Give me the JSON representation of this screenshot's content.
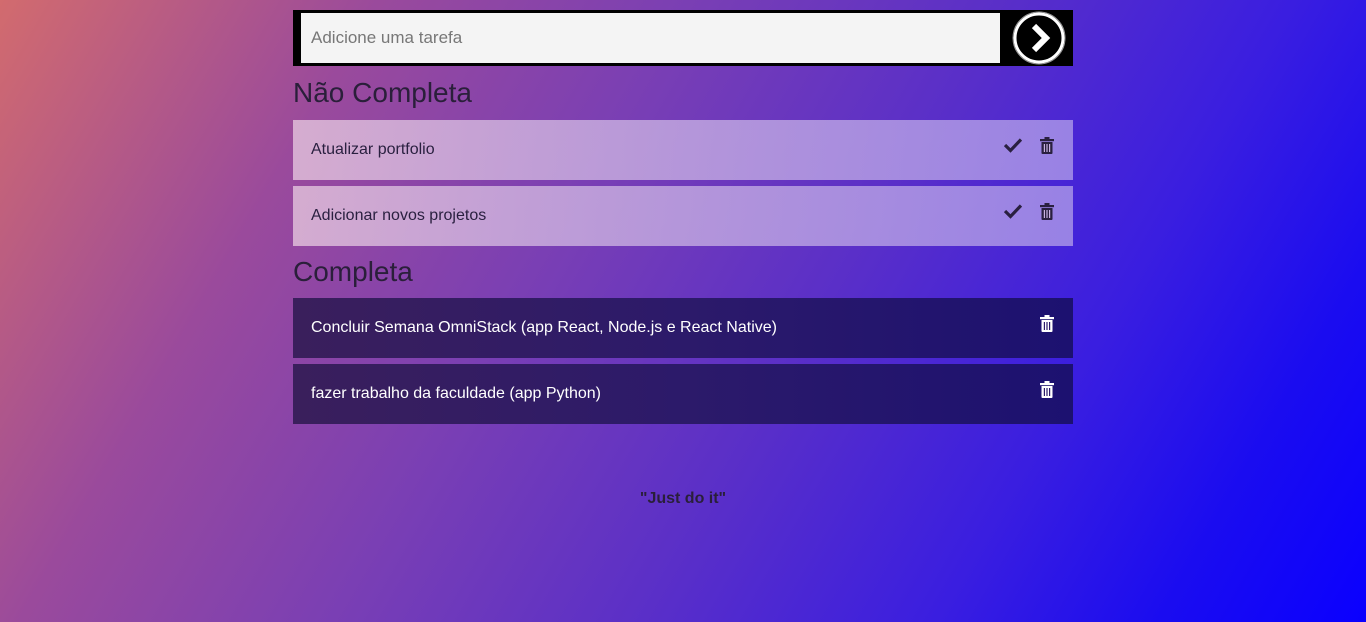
{
  "add_task": {
    "placeholder": "Adicione uma tarefa",
    "value": "",
    "submit_icon": "chevron-right-circle-icon"
  },
  "sections": {
    "pending_title": "Não Completa",
    "completed_title": "Completa"
  },
  "pending_tasks": [
    {
      "label": "Atualizar portfolio"
    },
    {
      "label": "Adicionar novos projetos"
    }
  ],
  "completed_tasks": [
    {
      "label": "Concluir Semana OmniStack (app React, Node.js e React Native)"
    },
    {
      "label": "fazer trabalho da faculdade (app Python)"
    }
  ],
  "icons": {
    "complete": "check-icon",
    "delete": "trash-icon"
  },
  "footer": {
    "quote": "\"Just do it\""
  },
  "colors": {
    "pending_icon": "#2a2040",
    "completed_icon": "#ffffff",
    "bar_background": "#000000"
  }
}
